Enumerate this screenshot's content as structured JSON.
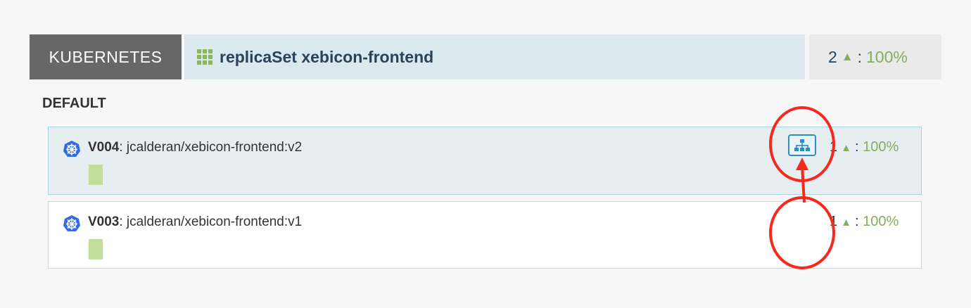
{
  "header": {
    "provider": "KUBERNETES",
    "cluster_label": "replicaSet xebicon-frontend",
    "health_count": "2",
    "health_separator": ":",
    "health_percent": "100%"
  },
  "group": {
    "title": "DEFAULT"
  },
  "server_groups": [
    {
      "version": "V004",
      "image": ": jcalderan/xebicon-frontend:v2",
      "count": "1",
      "separator": ":",
      "percent": "100%"
    },
    {
      "version": "V003",
      "image": ": jcalderan/xebicon-frontend:v1",
      "count": "1",
      "separator": ":",
      "percent": "100%"
    }
  ],
  "icons": {
    "grid": "grid-icon",
    "kubernetes": "kubernetes-icon",
    "load_balancer": "load-balancer-icon",
    "arrow": "arrow-up-icon"
  },
  "colors": {
    "provider_bg": "#676767",
    "cluster_bg": "#dbe8ee",
    "healthy": "#86ad5c",
    "instance": "#c3dd9b",
    "accent": "#2d8ec3",
    "annotation": "#f52a1e"
  }
}
